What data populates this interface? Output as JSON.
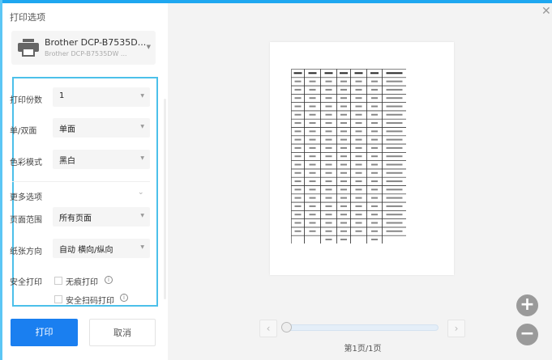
{
  "title": "打印选项",
  "printer": {
    "name": "Brother DCP-B7535D...",
    "sub": "Brother DCP-B7535DW ..."
  },
  "fields": {
    "copies": {
      "label": "打印份数",
      "value": "1"
    },
    "duplex": {
      "label": "单/双面",
      "value": "单面"
    },
    "color": {
      "label": "色彩模式",
      "value": "黑白"
    },
    "more": {
      "label": "更多选项"
    },
    "range": {
      "label": "页面范围",
      "value": "所有页面"
    },
    "orientation": {
      "label": "纸张方向",
      "value": "自动 横向/纵向"
    },
    "secure": {
      "label": "安全打印",
      "opt1": "无痕打印",
      "opt2": "安全扫码打印"
    }
  },
  "buttons": {
    "print": "打印",
    "cancel": "取消"
  },
  "preview": {
    "page_label": "第1页/1页",
    "rows": 19,
    "cols": 7,
    "slider": 0
  }
}
